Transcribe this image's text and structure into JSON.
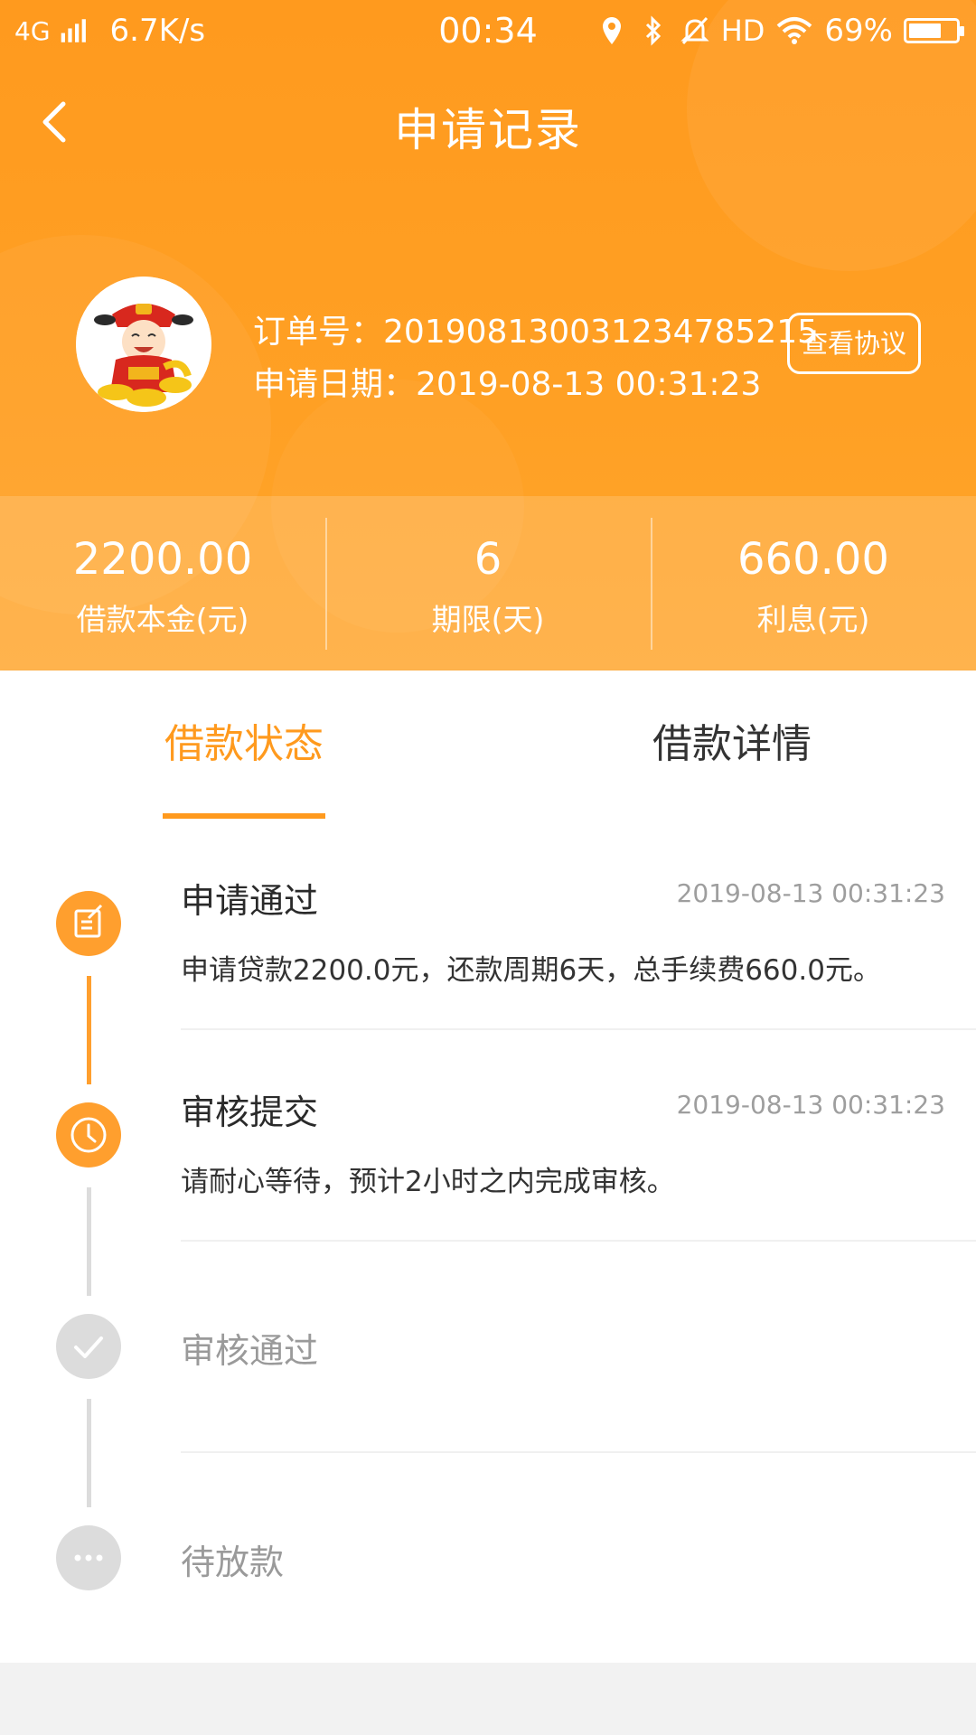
{
  "status_bar": {
    "network": "4G",
    "speed": "6.7K/s",
    "time": "00:34",
    "hd": "HD",
    "battery_percent": "69%",
    "battery_level": 0.69
  },
  "nav": {
    "title": "申请记录"
  },
  "order": {
    "number_label": "订单号：",
    "number": "20190813003123478521​5",
    "date_label": "申请日期：",
    "date": "2019-08-13 00:31:23",
    "agreement_button": "查看协议"
  },
  "stats": [
    {
      "value": "2200.00",
      "label": "借款本金(元)"
    },
    {
      "value": "6",
      "label": "期限(天)"
    },
    {
      "value": "660.00",
      "label": "利息(元)"
    }
  ],
  "tabs": [
    {
      "label": "借款状态",
      "active": true
    },
    {
      "label": "借款详情",
      "active": false
    }
  ],
  "steps": [
    {
      "title": "申请通过",
      "time": "2019-08-13 00:31:23",
      "desc": "申请贷款2200.0元，还款周期6天，总手续费660.0元。",
      "icon": "edit-icon",
      "state": "done"
    },
    {
      "title": "审核提交",
      "time": "2019-08-13 00:31:23",
      "desc": "请耐心等待，预计2小时之内完成审核。",
      "icon": "clock-icon",
      "state": "current"
    },
    {
      "title": "审核通过",
      "time": "",
      "desc": "",
      "icon": "check-icon",
      "state": "pending"
    },
    {
      "title": "待放款",
      "time": "",
      "desc": "",
      "icon": "more-icon",
      "state": "pending"
    }
  ],
  "colors": {
    "accent": "#ff9a1e",
    "pending": "#dcdcdc"
  }
}
